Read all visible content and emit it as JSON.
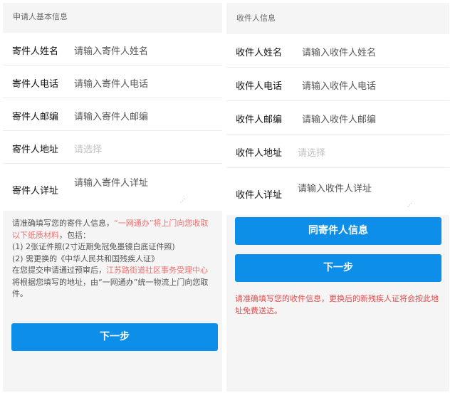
{
  "left": {
    "section_title": "申请人基本信息",
    "fields": [
      {
        "label": "寄件人姓名",
        "placeholder": "请输入寄件人姓名"
      },
      {
        "label": "寄件人电话",
        "placeholder": "请输入寄件人电话"
      },
      {
        "label": "寄件人邮编",
        "placeholder": "请输入寄件人邮编"
      },
      {
        "label": "寄件人地址",
        "placeholder": "请选择"
      },
      {
        "label": "寄件人详址",
        "placeholder": "请输入寄件人详址"
      }
    ],
    "notice": {
      "part1": "请准确填写您的寄件人信息，",
      "part2_red": "“一网通办”将上门向您收取以下纸质材料",
      "part3": "，包括：",
      "line2": "(1) 2张证件照(2寸近期免冠免墨镜白底证件照)",
      "line3": "(2) 需更换的《中华人民共和国残疾人证》",
      "part4": "在您提交申请通过预审后，",
      "part5_red": "江苏路街道社区事务受理中心",
      "part6": "将根据您填写的地址，由“一网通办”统一物流上门向您取件。"
    },
    "next_button": "下一步"
  },
  "right": {
    "section_title": "收件人信息",
    "fields": [
      {
        "label": "收件人姓名",
        "placeholder": "请输入收件人姓名"
      },
      {
        "label": "收件人电话",
        "placeholder": "请输入收件人电话"
      },
      {
        "label": "收件人邮编",
        "placeholder": "请输入收件人邮编"
      },
      {
        "label": "收件人地址",
        "placeholder": "请选择"
      },
      {
        "label": "收件人详址",
        "placeholder": "请输入收件人详址"
      }
    ],
    "same_button": "同寄件人信息",
    "next_button": "下一步",
    "warning": "请准确填写您的收件信息，更换后的新残疾人证将会按此地址免费送达。"
  },
  "colors": {
    "primary": "#0d8ee9",
    "warning": "#e84b4b",
    "notice_red": "#f07070"
  }
}
